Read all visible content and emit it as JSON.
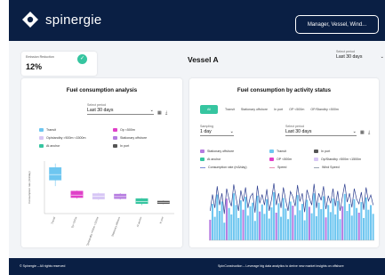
{
  "header": {
    "logo_text": "spinergie",
    "search_label": "Manager, Vessel, Wind..."
  },
  "kpi": {
    "label": "Emission Reduction",
    "value": "12%"
  },
  "vessel": {
    "title": "Vessel A"
  },
  "period_top": {
    "label": "Select period",
    "value": "Last 30 days"
  },
  "left_card": {
    "title": "Fuel consumption analysis",
    "period_label": "Select period",
    "period_value": "Last 30 days",
    "legend": [
      {
        "label": "Transit",
        "color": "#6ec6f0"
      },
      {
        "label": "Op <500m",
        "color": "#e040c8"
      },
      {
        "label": "Op/standby >500m <1500m",
        "color": "#d7c6f5"
      },
      {
        "label": "Stationary offshore",
        "color": "#b57be0"
      },
      {
        "label": "At anchor",
        "color": "#36c5a0"
      },
      {
        "label": "In port",
        "color": "#555555"
      }
    ]
  },
  "right_card": {
    "title": "Fuel consumption by activity status",
    "tabs": [
      "All",
      "Transit",
      "Stationary offshore",
      "In port",
      "OP <500m",
      "OP/Standby <500m"
    ],
    "sampling_label": "Sampling",
    "sampling_value": "1 day",
    "period_label": "Select period",
    "period_value": "Last 30 days",
    "legend": [
      {
        "label": "Stationary offshore",
        "color": "#b57be0",
        "kind": "box"
      },
      {
        "label": "Transit",
        "color": "#6ec6f0",
        "kind": "box"
      },
      {
        "label": "In port",
        "color": "#555555",
        "kind": "box"
      },
      {
        "label": "At anchor",
        "color": "#36c5a0",
        "kind": "box"
      },
      {
        "label": "OP <500m",
        "color": "#e040c8",
        "kind": "box"
      },
      {
        "label": "Op/Standby >500m <1500m",
        "color": "#d7c6f5",
        "kind": "box"
      },
      {
        "label": "Consumption rate (m3/day)",
        "color": "#7a8cd6",
        "kind": "line"
      },
      {
        "label": "Speed",
        "color": "#e68fb5",
        "kind": "line"
      },
      {
        "label": "Wind Speed",
        "color": "#9aa4b2",
        "kind": "line"
      }
    ]
  },
  "footer": {
    "left": "© Spinergie – All rights reserved",
    "right": "SpinConstruction – Leverage big data analytics to derive new market insights on offshore"
  },
  "chart_data": [
    {
      "type": "box",
      "ylabel": "Consumption rate (m3/day)",
      "categories": [
        "Transit",
        "Op <500m",
        "Op/standby >500m <1500m",
        "Stationary offshore",
        "At anchor",
        "In port"
      ],
      "colors": [
        "#6ec6f0",
        "#e040c8",
        "#d7c6f5",
        "#b57be0",
        "#36c5a0",
        "#555555"
      ],
      "boxes": [
        {
          "whisker_low": 0.55,
          "q1": 0.67,
          "median": 0.78,
          "q3": 0.92,
          "whisker_high": 1.0
        },
        {
          "whisker_low": 0.3,
          "q1": 0.32,
          "median": 0.37,
          "q3": 0.45,
          "whisker_high": 0.46
        },
        {
          "whisker_low": 0.27,
          "q1": 0.29,
          "median": 0.35,
          "q3": 0.4,
          "whisker_high": 0.42
        },
        {
          "whisker_low": 0.28,
          "q1": 0.3,
          "median": 0.34,
          "q3": 0.39,
          "whisker_high": 0.41
        },
        {
          "whisker_low": 0.17,
          "q1": 0.2,
          "median": 0.24,
          "q3": 0.3,
          "whisker_high": 0.31
        },
        {
          "whisker_low": 0.19,
          "q1": 0.2,
          "median": 0.22,
          "q3": 0.25,
          "whisker_high": 0.26
        }
      ],
      "ylim": [
        0,
        1.05
      ]
    },
    {
      "type": "bar",
      "ylim": [
        0,
        1
      ],
      "values": [
        0.35,
        0.62,
        0.4,
        0.78,
        0.5,
        0.66,
        0.3,
        0.71,
        0.55,
        0.44,
        0.8,
        0.6,
        0.38,
        0.68,
        0.52,
        0.74,
        0.42,
        0.58,
        0.64,
        0.33,
        0.76,
        0.49,
        0.61,
        0.45,
        0.7,
        0.37,
        0.56,
        0.82,
        0.47,
        0.63,
        0.4,
        0.72,
        0.54,
        0.36,
        0.66,
        0.59,
        0.43,
        0.77,
        0.51,
        0.62,
        0.34,
        0.69,
        0.57,
        0.46,
        0.8,
        0.41,
        0.64,
        0.53,
        0.75,
        0.39,
        0.6,
        0.48,
        0.71,
        0.44,
        0.67,
        0.36,
        0.58,
        0.79,
        0.5,
        0.62,
        0.42,
        0.7,
        0.55,
        0.47,
        0.65,
        0.38,
        0.73,
        0.52,
        0.6,
        0.45
      ],
      "colors": [
        "#6ec6f0",
        "#b57be0"
      ],
      "line": [
        0.5,
        0.78,
        0.55,
        0.92,
        0.6,
        0.8,
        0.45,
        0.88,
        0.7,
        0.58,
        0.95,
        0.72,
        0.5,
        0.85,
        0.66,
        0.9,
        0.55,
        0.74,
        0.8,
        0.47,
        0.93,
        0.63,
        0.78,
        0.6,
        0.87,
        0.5,
        0.7,
        0.97,
        0.6,
        0.8,
        0.55,
        0.9,
        0.68,
        0.5,
        0.83,
        0.74,
        0.58,
        0.94,
        0.66,
        0.8,
        0.48,
        0.86,
        0.72,
        0.6,
        0.96,
        0.55,
        0.8,
        0.68,
        0.92,
        0.53,
        0.76,
        0.63,
        0.88,
        0.58,
        0.84,
        0.5,
        0.74,
        0.96,
        0.65,
        0.8,
        0.56,
        0.88,
        0.7,
        0.62,
        0.82,
        0.52,
        0.9,
        0.67,
        0.77,
        0.6
      ]
    }
  ]
}
